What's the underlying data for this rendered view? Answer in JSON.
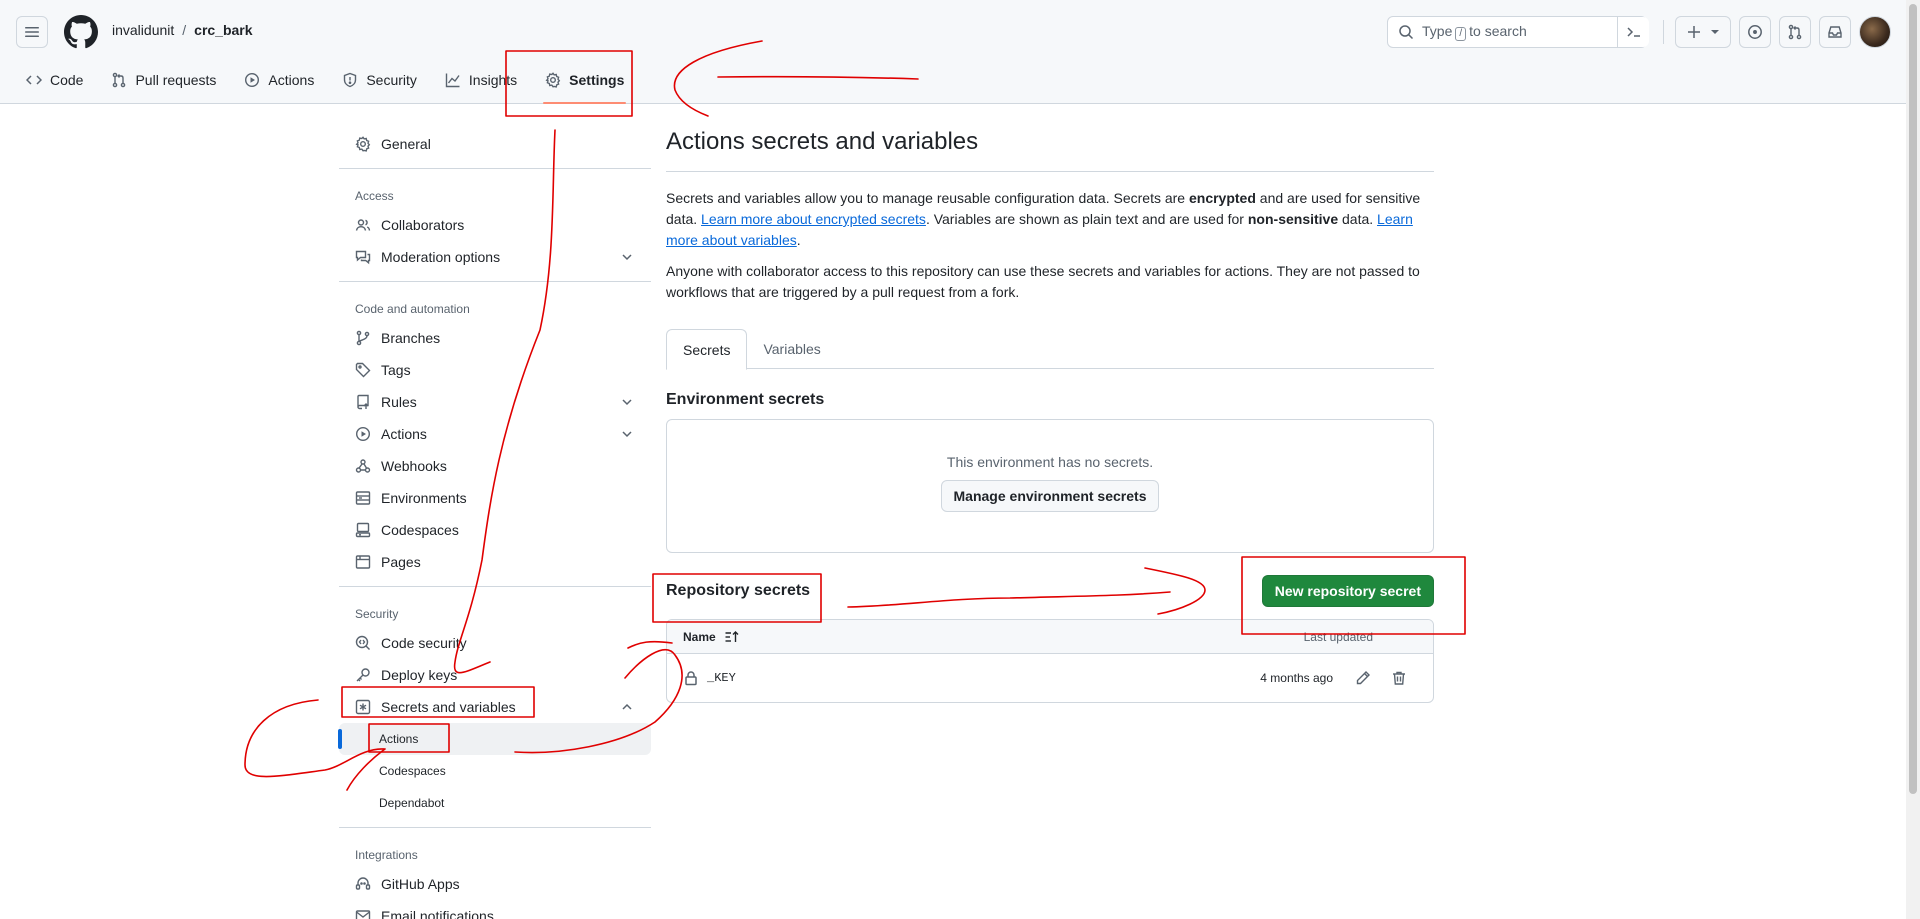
{
  "header": {
    "owner": "invalidunit",
    "separator": "/",
    "repo": "crc_bark",
    "search_prefix": "Type",
    "search_key": "/",
    "search_suffix": "to search"
  },
  "repo_tabs": [
    {
      "label": "Code",
      "icon": "code-icon"
    },
    {
      "label": "Pull requests",
      "icon": "git-pull-request-icon"
    },
    {
      "label": "Actions",
      "icon": "play-icon"
    },
    {
      "label": "Security",
      "icon": "shield-icon"
    },
    {
      "label": "Insights",
      "icon": "graph-icon"
    },
    {
      "label": "Settings",
      "icon": "gear-icon",
      "selected": true
    }
  ],
  "sidebar": {
    "general": "General",
    "access_title": "Access",
    "collaborators": "Collaborators",
    "moderation": "Moderation options",
    "code_automation_title": "Code and automation",
    "branches": "Branches",
    "tags": "Tags",
    "rules": "Rules",
    "actions": "Actions",
    "webhooks": "Webhooks",
    "environments": "Environments",
    "codespaces": "Codespaces",
    "pages": "Pages",
    "security_title": "Security",
    "code_security": "Code security",
    "deploy_keys": "Deploy keys",
    "secrets_variables": "Secrets and variables",
    "sub_actions": "Actions",
    "sub_codespaces": "Codespaces",
    "sub_dependabot": "Dependabot",
    "integrations_title": "Integrations",
    "github_apps": "GitHub Apps",
    "email_notifications": "Email notifications"
  },
  "main": {
    "title": "Actions secrets and variables",
    "p1_a": "Secrets and variables allow you to manage reusable configuration data. Secrets are ",
    "p1_b": "encrypted",
    "p1_c": " and are used for sensitive data. ",
    "p1_link1": "Learn more about encrypted secrets",
    "p1_d": ". Variables are shown as plain text and are used for ",
    "p1_e": "non-sensitive",
    "p1_f": " data. ",
    "p1_link2": "Learn more about variables",
    "p1_g": ".",
    "p2": "Anyone with collaborator access to this repository can use these secrets and variables for actions. They are not passed to workflows that are triggered by a pull request from a fork.",
    "tab_secrets": "Secrets",
    "tab_variables": "Variables",
    "env_title": "Environment secrets",
    "env_empty": "This environment has no secrets.",
    "env_button": "Manage environment secrets",
    "repo_title": "Repository secrets",
    "new_button": "New repository secret",
    "col_name": "Name",
    "col_updated": "Last updated",
    "secrets": [
      {
        "name": "_KEY",
        "updated": "4 months ago"
      }
    ]
  },
  "colors": {
    "accent": "#0969da",
    "primary_button": "#1f883d",
    "annotation": "#e00000",
    "tab_underline": "#fd8c73"
  }
}
